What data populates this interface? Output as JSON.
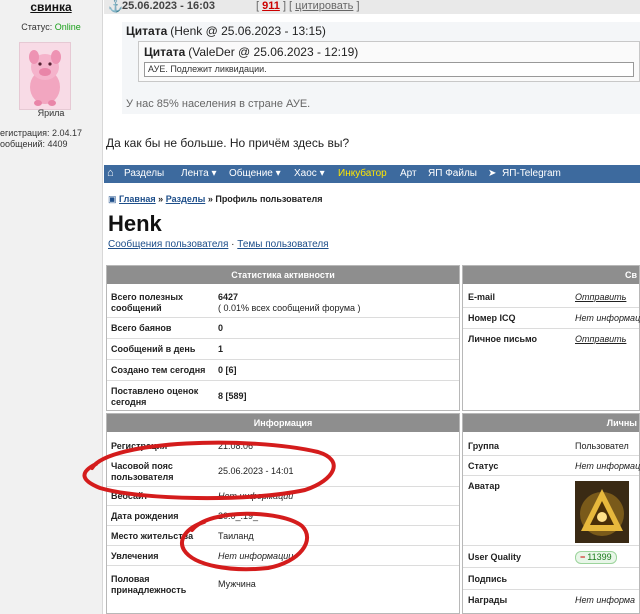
{
  "author": {
    "name": "свинка",
    "status_label": "Статус:",
    "status_value": "Online",
    "rank": "Ярила",
    "registration": "егистрация: 2.04.17",
    "messages": "ообщений: 4409"
  },
  "post": {
    "anchor": "⚓",
    "date": "25.06.2023 - 16:03",
    "bracket_open": "[",
    "rating": "911",
    "bracket_mid": "] [",
    "quote_link": "цитировать",
    "bracket_close": "]",
    "text": "Да как бы не больше. Но причём здесь вы?"
  },
  "quote_outer": {
    "label": "Цитата",
    "meta": "(Henk @ 25.06.2023 - 13:15)",
    "body": "У нас 85% населения в стране АУЕ."
  },
  "quote_inner": {
    "label": "Цитата",
    "meta": "(ValeDer @ 25.06.2023 - 12:19)",
    "body": "АУЕ. Подлежит ликвидации."
  },
  "profile": {
    "nav": {
      "home_icon": "house-icon",
      "items": [
        "Разделы",
        "Лента ▾",
        "Общение ▾",
        "Хаос ▾",
        "Инкубатор",
        "Арт",
        "ЯП Файлы",
        "ЯП-Telegram"
      ],
      "incubator_color": "#ffe600"
    },
    "breadcrumb": {
      "home": "Главная",
      "sep1": "»",
      "sections": "Разделы",
      "sep2": "»",
      "current": "Профиль пользователя"
    },
    "username": "Henk",
    "links": {
      "posts": "Сообщения пользователя",
      "sep": "·",
      "topics": "Темы пользователя"
    },
    "stats": {
      "header": "Статистика активности",
      "rows": [
        {
          "label": "Всего полезных сообщений",
          "value": "6427",
          "note": "( 0.01% всех сообщений форума )"
        },
        {
          "label": "Всего баянов",
          "value": "0"
        },
        {
          "label": "Сообщений в день",
          "value": "1"
        },
        {
          "label": "Создано тем сегодня",
          "value": "0 [6]"
        },
        {
          "label": "Поставлено оценок сегодня",
          "value": "8 [589]"
        }
      ]
    },
    "contacts": {
      "header": "Св",
      "rows": [
        {
          "label": "E-mail",
          "value": "Отправить"
        },
        {
          "label": "Номер ICQ",
          "value": "Нет информац"
        },
        {
          "label": "Личное письмо",
          "value": "Отправить"
        }
      ]
    },
    "info": {
      "header": "Информация",
      "rows": [
        {
          "label": "Регистрация",
          "value": "21.08.06"
        },
        {
          "label": "Часовой пояс пользователя",
          "value": "25.06.2023 - 14:01"
        },
        {
          "label": "Вебсайт",
          "value": "Нет информации"
        },
        {
          "label": "Дата рождения",
          "value": "20.0_.19_"
        },
        {
          "label": "Место жительства",
          "value": "Таиланд"
        },
        {
          "label": "Увлечения",
          "value": "Нет информации"
        },
        {
          "label": "Половая принадлежность",
          "value": "Мужчина"
        }
      ]
    },
    "personal": {
      "header": "Личны",
      "rows": [
        {
          "label": "Группа",
          "value": "Пользовател"
        },
        {
          "label": "Статус",
          "value": "Нет информац"
        },
        {
          "label": "Аватар",
          "value": ""
        },
        {
          "label": "User Quality",
          "value": "11399",
          "minus": "−"
        },
        {
          "label": "Подпись",
          "value": ""
        },
        {
          "label": "Награды",
          "value": "Нет информа"
        }
      ]
    }
  },
  "colors": {
    "nav_bg": "#3d6a9e",
    "panel_header": "#8e8e8e",
    "annotation": "#d41c1c",
    "online": "#1aa01a",
    "rating": "#cc0000",
    "link": "#1d4e8a"
  }
}
